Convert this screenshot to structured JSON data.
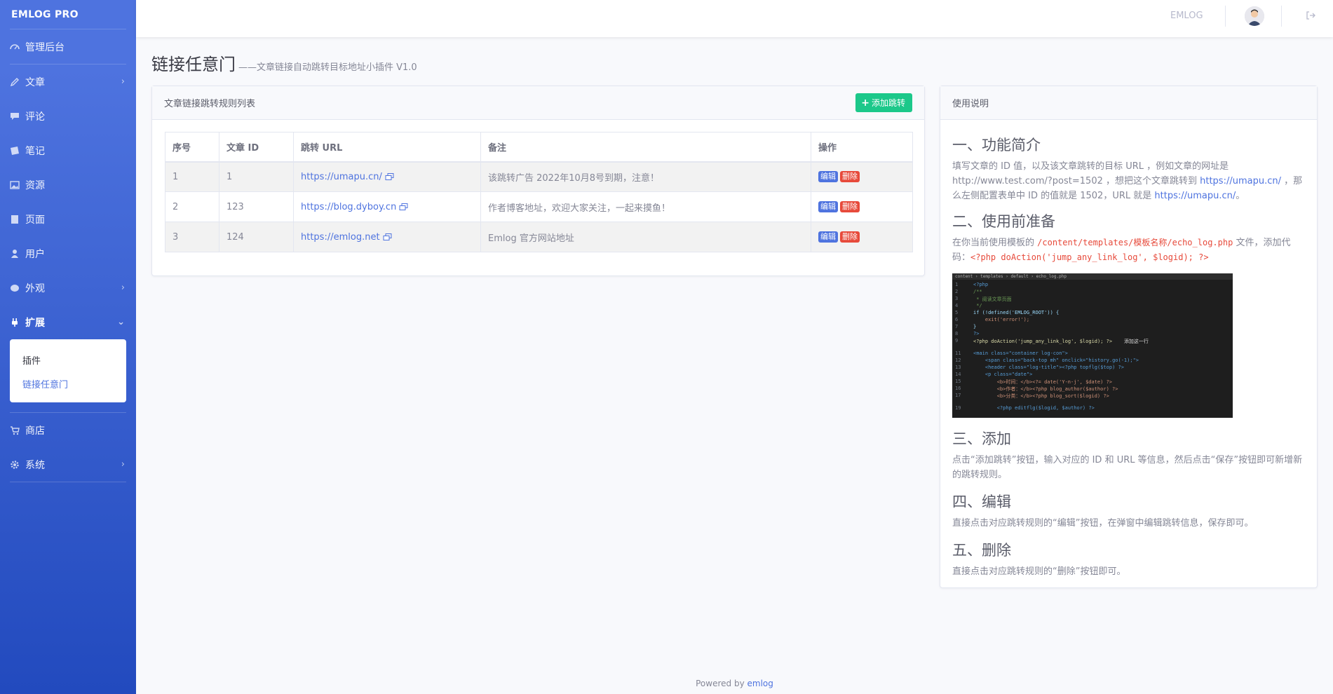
{
  "brand": "EMLOG PRO",
  "sidebar": {
    "items": [
      {
        "label": "管理后台",
        "icon": "dashboard-icon"
      },
      {
        "label": "文章",
        "icon": "pencil-icon",
        "chevron": "›"
      },
      {
        "label": "评论",
        "icon": "comment-icon"
      },
      {
        "label": "笔记",
        "icon": "note-icon"
      },
      {
        "label": "资源",
        "icon": "image-icon"
      },
      {
        "label": "页面",
        "icon": "page-icon"
      },
      {
        "label": "用户",
        "icon": "user-icon"
      },
      {
        "label": "外观",
        "icon": "palette-icon",
        "chevron": "›"
      },
      {
        "label": "扩展",
        "icon": "plug-icon",
        "chevron": "⌄"
      },
      {
        "label": "商店",
        "icon": "cart-icon"
      },
      {
        "label": "系统",
        "icon": "gear-icon",
        "chevron": "›"
      }
    ],
    "submenu": [
      "插件",
      "链接任意门"
    ]
  },
  "topbar": {
    "link": "EMLOG"
  },
  "page": {
    "title": "链接任意门",
    "dash": "——",
    "subtitle": " 文章链接自动跳转目标地址小插件 V1.0"
  },
  "rules_card": {
    "title": "文章链接跳转规则列表",
    "add_button": "添加跳转",
    "columns": [
      "序号",
      "文章 ID",
      "跳转 URL",
      "备注",
      "操作"
    ],
    "rows": [
      {
        "no": "1",
        "id": "1",
        "url": "https://umapu.cn/",
        "note": "该跳转广告 2022年10月8号到期，注意！"
      },
      {
        "no": "2",
        "id": "123",
        "url": "https://blog.dyboy.cn",
        "note": "作者博客地址，欢迎大家关注，一起来摸鱼！"
      },
      {
        "no": "3",
        "id": "124",
        "url": "https://emlog.net",
        "note": "Emlog 官方网站地址"
      }
    ],
    "edit_label": "编辑",
    "delete_label": "删除"
  },
  "help_card": {
    "title": "使用说明",
    "s1_title": "一、功能简介",
    "s1_text_a": "填写文章的 ID 值，以及该文章跳转的目标 URL ，例如文章的网址是 http://www.test.com/?post=1502 ，想把这个文章跳转到 ",
    "s1_link": "https://umapu.cn/",
    "s1_text_b": " ，那么左侧配置表单中 ID 的值就是 1502，URL 就是 ",
    "s1_link2": "https://umapu.cn/",
    "s1_text_c": "。",
    "s2_title": "二、使用前准备",
    "s2_text_a": "在你当前使用模板的 ",
    "s2_code1": "/content/templates/模板名称/echo_log.php",
    "s2_text_b": " 文件，添加代码：",
    "s2_code2": "<?php doAction('jump_any_link_log', $logid); ?>",
    "s3_title": "三、添加",
    "s3_text": "点击“添加跳转”按钮，输入对应的 ID 和 URL 等信息，然后点击“保存”按钮即可新增新的跳转规则。",
    "s4_title": "四、编辑",
    "s4_text": "直接点击对应跳转规则的“编辑”按钮，在弹窗中编辑跳转信息，保存即可。",
    "s5_title": "五、删除",
    "s5_text": "直接点击对应跳转规则的“删除”按钮即可。"
  },
  "footer": {
    "text": "Powered by ",
    "link": "emlog"
  }
}
